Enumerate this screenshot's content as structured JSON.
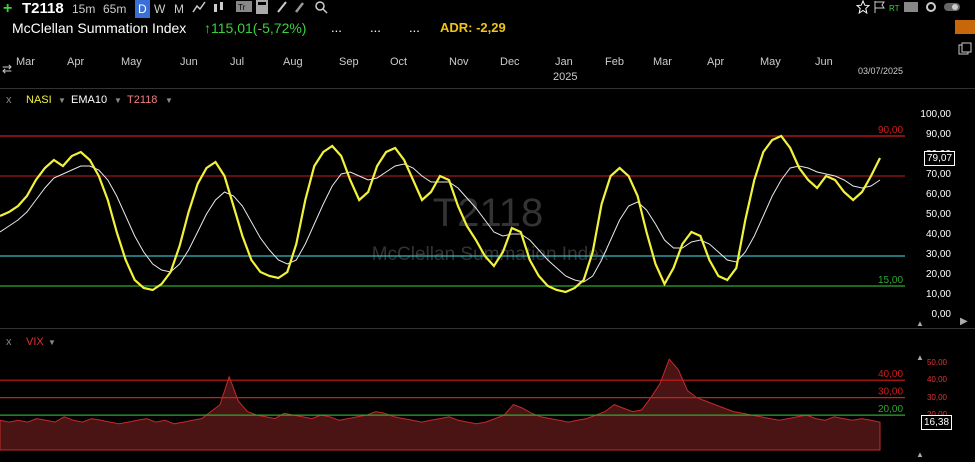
{
  "toolbar": {
    "symbol": "T2118",
    "timeframes": [
      {
        "label": "15m",
        "active": false
      },
      {
        "label": "65m",
        "active": false
      },
      {
        "label": "D",
        "active": true
      },
      {
        "label": "W",
        "active": false
      },
      {
        "label": "M",
        "active": false
      }
    ]
  },
  "header": {
    "title": "McClellan Summation Index",
    "price": "115,01",
    "change": "(-5,72%)",
    "dots": [
      "...",
      "...",
      "..."
    ],
    "adr": "ADR: -2,29"
  },
  "time_axis": {
    "months": [
      "Mar",
      "Apr",
      "May",
      "Jun",
      "Jul",
      "Aug",
      "Sep",
      "Oct",
      "Nov",
      "Dec",
      "Jan",
      "Feb",
      "Mar",
      "Apr",
      "May",
      "Jun"
    ],
    "year": "2025",
    "date": "03/07/2025"
  },
  "watermark": {
    "symbol": "T2118",
    "name": "McClellan Summation Index"
  },
  "main_panel": {
    "legend": {
      "close": "x",
      "items": [
        "NASI",
        "EMA10",
        "T2118"
      ]
    },
    "ticks": [
      "100,00",
      "90,00",
      "80,00",
      "70,00",
      "60,00",
      "50,00",
      "40,00",
      "30,00",
      "20,00",
      "10,00",
      "0,00"
    ],
    "levels": [
      "90,00",
      "15,00"
    ],
    "last": "79,07",
    "colors": {
      "series": "#f2f23a",
      "ema": "#e8e8e8",
      "red": "#d01c1c",
      "cyan": "#3bb8c4",
      "green": "#2fa82f"
    },
    "series": [
      50,
      52,
      55,
      60,
      68,
      74,
      78,
      75,
      80,
      82,
      78,
      70,
      58,
      42,
      28,
      18,
      14,
      13,
      16,
      22,
      35,
      52,
      66,
      74,
      77,
      70,
      55,
      40,
      28,
      22,
      20,
      19,
      22,
      36,
      58,
      75,
      82,
      85,
      80,
      68,
      58,
      62,
      75,
      82,
      84,
      78,
      68,
      58,
      62,
      70,
      68,
      55,
      45,
      38,
      30,
      25,
      32,
      44,
      42,
      28,
      20,
      15,
      13,
      12,
      14,
      18,
      32,
      56,
      70,
      74,
      70,
      60,
      42,
      26,
      16,
      24,
      36,
      42,
      40,
      28,
      20,
      18,
      24,
      48,
      68,
      82,
      88,
      90,
      84,
      74,
      68,
      64,
      70,
      68,
      62,
      58,
      62,
      70,
      79
    ],
    "ema": [
      42,
      45,
      48,
      52,
      58,
      64,
      69,
      71,
      73,
      75,
      75,
      73,
      68,
      60,
      50,
      40,
      32,
      26,
      23,
      22,
      26,
      33,
      42,
      51,
      58,
      62,
      60,
      55,
      47,
      39,
      33,
      28,
      26,
      28,
      36,
      46,
      56,
      65,
      71,
      72,
      70,
      68,
      69,
      72,
      75,
      76,
      74,
      70,
      67,
      67,
      67,
      64,
      59,
      54,
      48,
      42,
      40,
      41,
      41,
      38,
      33,
      28,
      24,
      20,
      18,
      17,
      20,
      28,
      38,
      48,
      55,
      57,
      53,
      46,
      38,
      34,
      34,
      37,
      38,
      36,
      32,
      28,
      27,
      32,
      40,
      50,
      60,
      68,
      74,
      75,
      74,
      72,
      71,
      70,
      68,
      65,
      64,
      65,
      68
    ]
  },
  "vix_panel": {
    "legend": {
      "close": "x",
      "label": "VIX"
    },
    "ticks": [
      "50,00",
      "40,00",
      "30,00",
      "20,00"
    ],
    "levels": [
      "40,00",
      "30,00",
      "20,00"
    ],
    "last": "16,38",
    "series": [
      17,
      16,
      17,
      16,
      18,
      17,
      16,
      19,
      17,
      16,
      18,
      17,
      16,
      15,
      16,
      17,
      18,
      16,
      17,
      15,
      16,
      17,
      18,
      22,
      26,
      42,
      28,
      22,
      20,
      19,
      18,
      21,
      20,
      19,
      18,
      20,
      19,
      17,
      18,
      19,
      20,
      22,
      21,
      19,
      18,
      17,
      16,
      17,
      18,
      19,
      17,
      16,
      15,
      16,
      18,
      20,
      26,
      24,
      21,
      19,
      18,
      17,
      16,
      17,
      18,
      20,
      22,
      26,
      24,
      22,
      23,
      30,
      38,
      52,
      46,
      34,
      30,
      28,
      26,
      24,
      22,
      21,
      20,
      19,
      18,
      17,
      18,
      19,
      20,
      18,
      17,
      19,
      18,
      17,
      18,
      17,
      16
    ]
  }
}
